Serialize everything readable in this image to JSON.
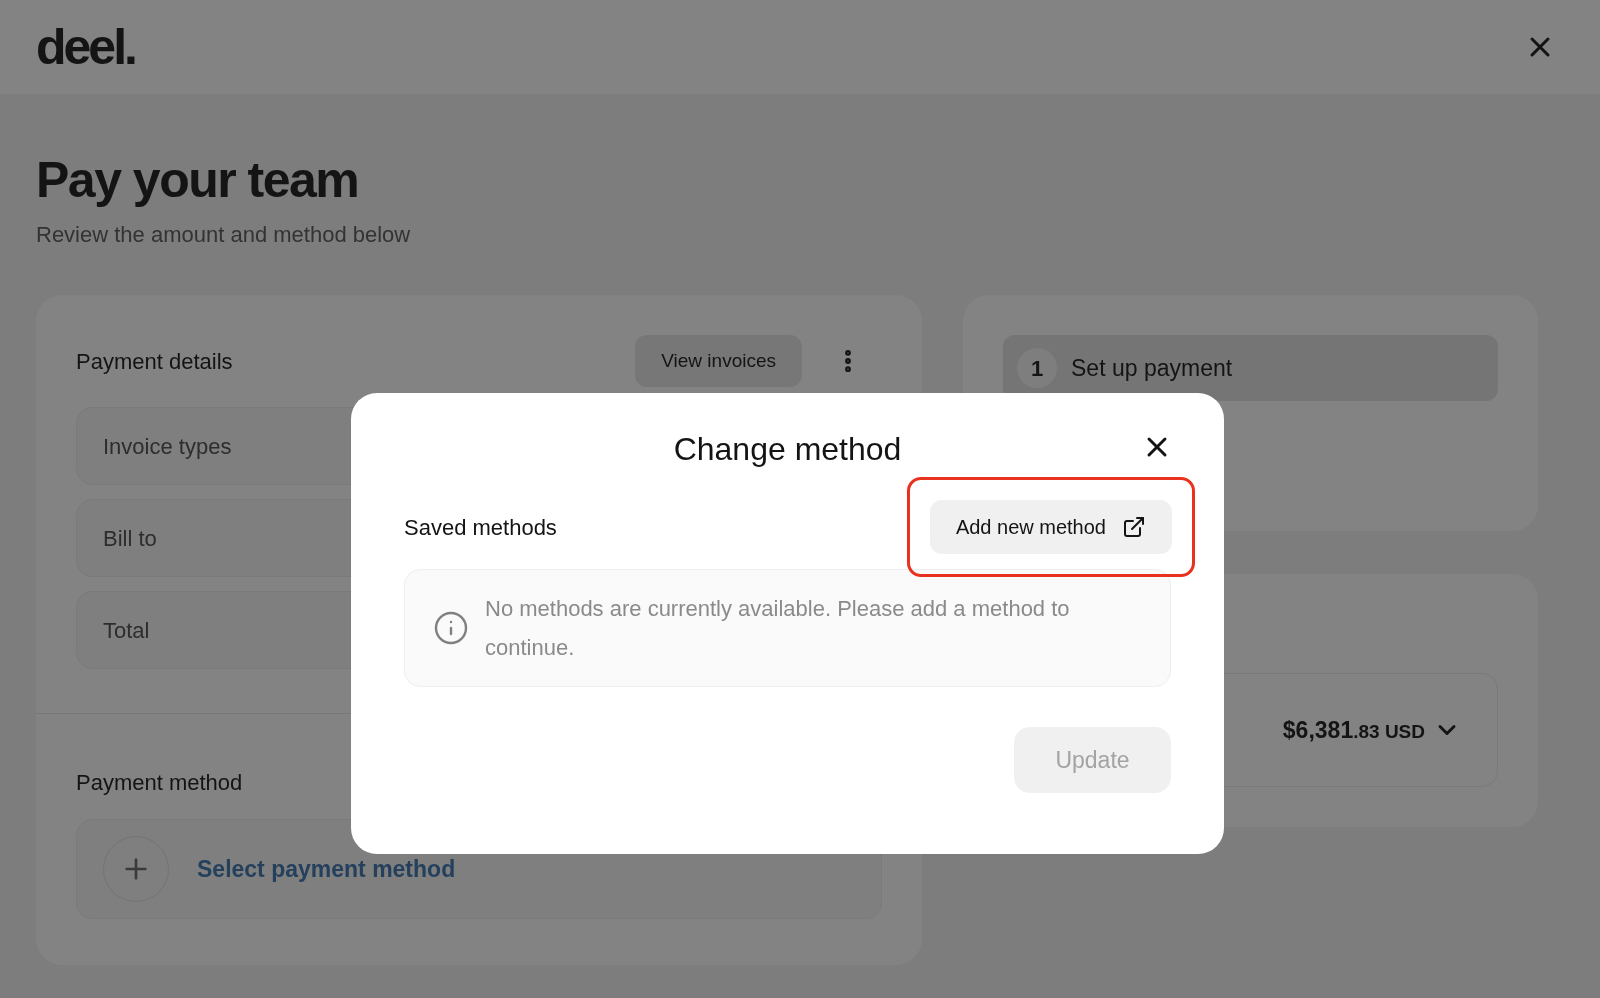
{
  "header": {
    "logo": "deel."
  },
  "page": {
    "title": "Pay your team",
    "subtitle": "Review the amount and method below"
  },
  "payment_details": {
    "title": "Payment details",
    "view_invoices": "View invoices",
    "rows": [
      {
        "label": "Invoice types"
      },
      {
        "label": "Bill to"
      },
      {
        "label": "Total"
      }
    ]
  },
  "payment_method": {
    "title": "Payment method",
    "select_label": "Select payment method"
  },
  "steps": [
    {
      "number": "1",
      "label": "Set up payment",
      "selected": true
    }
  ],
  "amount": {
    "whole": "$6,381",
    "fraction": ".83 USD"
  },
  "modal": {
    "title": "Change method",
    "section": "Saved methods",
    "add_button": {
      "label": "Add new method",
      "highlighted": true
    },
    "notice": "No methods are currently available. Please add a method to continue.",
    "update_button": {
      "label": "Update",
      "disabled": true
    }
  }
}
